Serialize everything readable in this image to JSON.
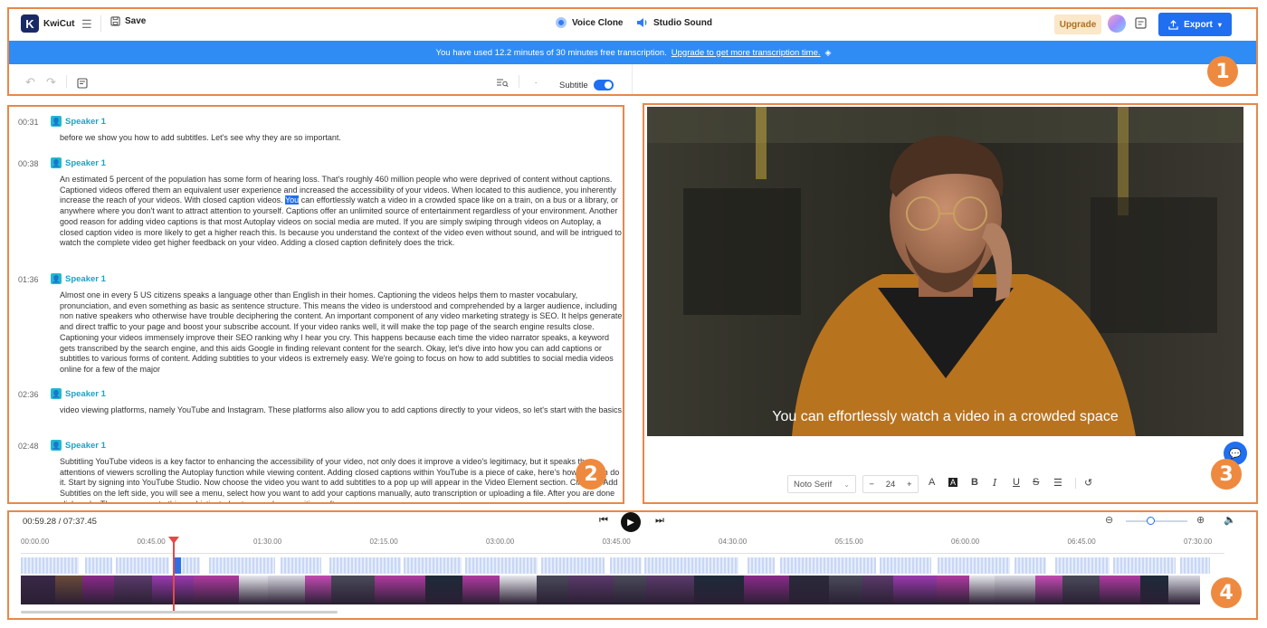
{
  "app": {
    "name": "KwiCut",
    "logo_letter": "K"
  },
  "topbar": {
    "save_label": "Save",
    "voice_clone_label": "Voice Clone",
    "studio_sound_label": "Studio Sound",
    "upgrade_label": "Upgrade",
    "export_label": "Export"
  },
  "banner": {
    "message": "You have used 12.2 minutes of 30 minutes free transcription.",
    "link": "Upgrade to get more transcription time."
  },
  "toolbar": {
    "subtitle_label": "Subtitle",
    "subtitle_on": true
  },
  "transcript": {
    "segments": [
      {
        "time": "00:31",
        "speaker": "Speaker 1",
        "text": "before we show you how to add subtitles. Let's see why they are so important."
      },
      {
        "time": "00:38",
        "speaker": "Speaker 1",
        "text_before": "An estimated 5 percent of the population has some form of hearing loss. That's roughly 460 million people who were deprived of content without captions. Captioned videos offered them an equivalent user experience and increased the accessibility of your videos. When located to this audience, you inherently increase the reach of your videos. With closed caption videos.",
        "highlight": "You",
        "text_after": "can effortlessly watch a video in a crowded space like on a train, on a bus or a library, or anywhere where you don't want to attract attention to yourself. Captions offer an unlimited source of entertainment regardless of your environment. Another good reason for adding video captions is that most Autoplay videos on social media are muted. If you are simply swiping through videos on Autoplay, a closed caption video is more likely to get a higher reach this. Is because you understand the context of the video even without sound, and will be intrigued to watch the complete video get higher feedback on your video. Adding a closed caption definitely does the trick."
      },
      {
        "time": "01:36",
        "speaker": "Speaker 1",
        "text": "Almost one in every 5 US citizens speaks a language other than English in their homes. Captioning the videos helps them to master vocabulary, pronunciation, and even something as basic as sentence structure. This means the video is understood and comprehended by a larger audience, including non native speakers who otherwise have trouble deciphering the content. An important component of any video marketing strategy is SEO. It helps generate and direct traffic to your page and boost your subscribe account. If your video ranks well, it will make the top page of the search engine results close. Captioning your videos immensely improve their SEO ranking why I hear you cry. This happens because each time the video narrator speaks, a keyword gets transcribed by the search engine, and this aids Google in finding relevant content for the search. Okay, let's dive into how you can add captions or subtitles to various forms of content. Adding subtitles to your videos is extremely easy. We're going to focus on how to add subtitles to social media videos online for a few of the major"
      },
      {
        "time": "02:36",
        "speaker": "Speaker 1",
        "text": "video viewing platforms, namely YouTube and Instagram. These platforms also allow you to add captions directly to your videos, so let's start with the basics."
      },
      {
        "time": "02:48",
        "speaker": "Speaker 1",
        "text": "Subtitling YouTube videos is a key factor to enhancing the accessibility of your video, not only does it improve a video's legitimacy, but it speaks the attentions of viewers scrolling the Autoplay function while viewing content. Adding closed captions within YouTube is a piece of cake, here's how you can do it. Start by signing into YouTube Studio. Now choose the video you want to add subtitles to a pop up will appear in the Video Element section. Click on, Add Subtitles on the left side, you will see a menu, select how you want to add your captions manually, auto transcription or uploading a file. After you are done click and... There are more to this sophisticated auto speech recognition software now..."
      }
    ]
  },
  "video": {
    "subtitle": "You can effortlessly watch a video in a crowded space",
    "font_name": "Noto Serif",
    "font_size": "24"
  },
  "timeline": {
    "current": "00:59.28",
    "separator": "/",
    "total": "07:37.45",
    "zoom_level": 0.4,
    "ruler_labels": [
      "00:00.00",
      "00:45.00",
      "01:30.00",
      "02:15.00",
      "03:00.00",
      "03:45.00",
      "04:30.00",
      "05:15.00",
      "06:00.00",
      "06:45.00",
      "07:30.00"
    ]
  },
  "callouts": [
    "1",
    "2",
    "3",
    "4"
  ],
  "colors": {
    "accent": "#1f6ff0",
    "banner": "#2f8cf5",
    "callout": "#ee8a3f",
    "speaker": "#1ea3c4"
  }
}
